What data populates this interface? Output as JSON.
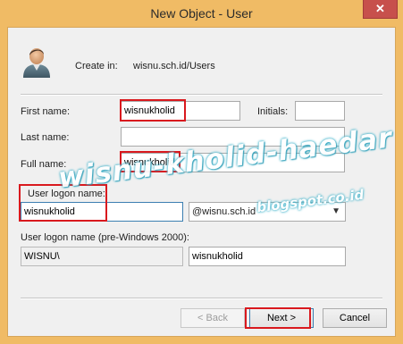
{
  "window": {
    "title": "New Object - User",
    "close_glyph": "✕"
  },
  "header": {
    "create_in_label": "Create in:",
    "create_in_path": "wisnu.sch.id/Users",
    "icon": "user-icon"
  },
  "form": {
    "first_name_label": "First name:",
    "first_name_value": "wisnukholid",
    "initials_label": "Initials:",
    "initials_value": "",
    "last_name_label": "Last name:",
    "last_name_value": "",
    "full_name_label": "Full name:",
    "full_name_value": "wisnukholid",
    "logon_name_label": "User logon name:",
    "logon_name_value": "wisnukholid",
    "domain_selected": "@wisnu.sch.id",
    "pre2000_label": "User logon name (pre-Windows 2000):",
    "pre2000_domain": "WISNU\\",
    "pre2000_value": "wisnukholid"
  },
  "buttons": {
    "back": "< Back",
    "next": "Next >",
    "cancel": "Cancel"
  },
  "watermark": {
    "main": "wisnu-kholid-haedar",
    "sub": "blogspot.co.id"
  },
  "colors": {
    "title_bar": "#f0bb65",
    "close_button": "#c7504c",
    "highlight": "#d9191e",
    "focus_border": "#3c7fb1"
  }
}
